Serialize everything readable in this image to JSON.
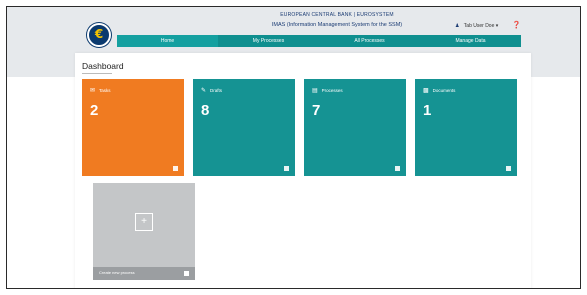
{
  "header": {
    "bank_name": "EUROPEAN CENTRAL BANK | EUROSYSTEM",
    "system_name": "IMAS (Information Management System for the SSM)",
    "user_label": "Tab User Doe",
    "logo_symbol": "€"
  },
  "nav": {
    "items": [
      {
        "label": "Home"
      },
      {
        "label": "My Processes"
      },
      {
        "label": "All Processes"
      },
      {
        "label": "Manage Data"
      }
    ]
  },
  "page": {
    "title": "Dashboard"
  },
  "tiles": [
    {
      "label": "Tasks",
      "count": "2",
      "color": "#f07b21"
    },
    {
      "label": "Drafts",
      "count": "8",
      "color": "#159393"
    },
    {
      "label": "Processes",
      "count": "7",
      "color": "#159393"
    },
    {
      "label": "Documents",
      "count": "1",
      "color": "#159393"
    }
  ],
  "add_tile": {
    "label": "Create new process"
  },
  "colors": {
    "nav_teal": "#0f8f8f",
    "accent_orange": "#f07b21",
    "brand_blue": "#0b3a6e"
  }
}
